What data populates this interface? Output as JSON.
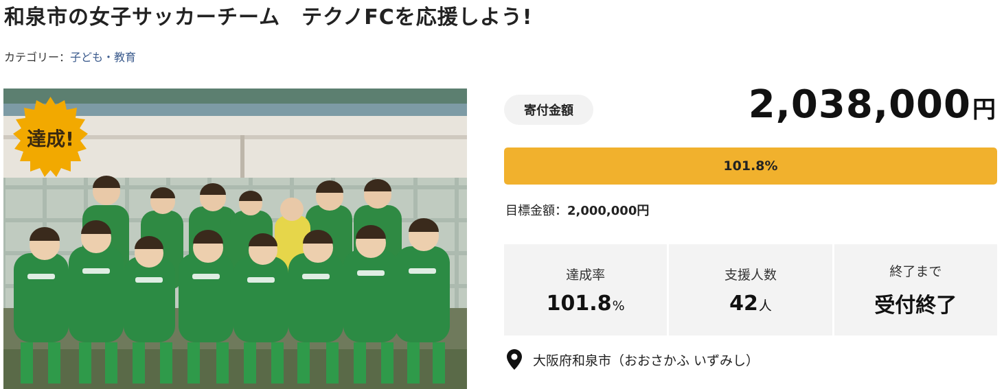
{
  "project": {
    "title": "和泉市の女子サッカーチーム　テクノFCを応援しよう!",
    "category_prefix": "カテゴリー：",
    "category": "子ども・教育"
  },
  "photo": {
    "badge_label": "達成!"
  },
  "donation": {
    "label": "寄付金額",
    "amount": "2,038,000",
    "currency": "円",
    "progress_text": "101.8%",
    "progress_percent": 101.8,
    "target_label": "目標金額：",
    "target_value": "2,000,000円"
  },
  "stats": {
    "rate": {
      "label": "達成率",
      "value": "101.8",
      "unit": "%"
    },
    "supporters": {
      "label": "支援人数",
      "value": "42",
      "unit": "人"
    },
    "remaining": {
      "label": "終了まで",
      "value": "受付終了"
    }
  },
  "location": {
    "text": "大阪府和泉市（おおさかふ いずみし）"
  },
  "colors": {
    "accent": "#f1b12d",
    "badge": "#f2a900",
    "category_link": "#3a5a8c",
    "panel": "#f3f3f3"
  },
  "icons": {
    "badge": "starburst-badge",
    "location": "map-pin-icon"
  }
}
